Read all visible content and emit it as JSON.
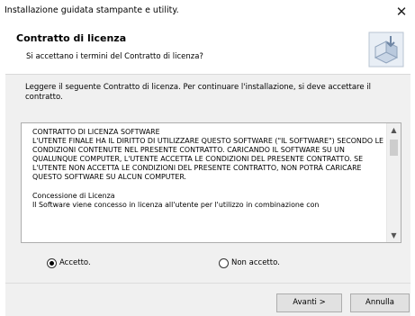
{
  "window": {
    "title": "Installazione guidata stampante e utility.",
    "close_symbol": "✕"
  },
  "header": {
    "title": "Contratto di licenza",
    "subtitle": "Si accettano i termini del Contratto di licenza?",
    "icon": "installer-box-icon"
  },
  "intro_text": "Leggere il seguente Contratto di licenza. Per continuare l'installazione, si deve accettare il contratto.",
  "license": {
    "text": "CONTRATTO DI LICENZA SOFTWARE\nL'UTENTE FINALE HA IL DIRITTO DI UTILIZZARE QUESTO SOFTWARE (\"IL SOFTWARE\") SECONDO LE CONDIZIONI CONTENUTE NEL PRESENTE CONTRATTO. CARICANDO IL SOFTWARE SU UN QUALUNQUE COMPUTER, L'UTENTE ACCETTA LE CONDIZIONI DEL PRESENTE CONTRATTO. SE L'UTENTE NON ACCETTA LE CONDIZIONI DEL PRESENTE CONTRATTO, NON POTRÀ CARICARE QUESTO SOFTWARE SU ALCUN COMPUTER.\n\nConcessione di Licenza\nIl Software viene concesso in licenza all'utente per l'utilizzo in combinazione con",
    "scroll_up": "▲",
    "scroll_down": "▼"
  },
  "options": {
    "accept_label": "Accetto.",
    "decline_label": "Non accetto.",
    "selected": "accept"
  },
  "buttons": {
    "next_label": "Avanti >",
    "cancel_label": "Annulla"
  }
}
